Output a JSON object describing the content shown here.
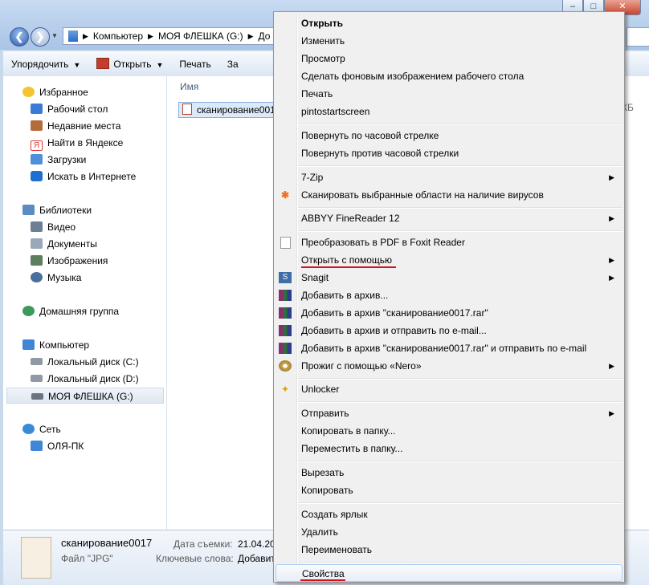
{
  "window": {
    "buttons": [
      "–",
      "□",
      "✕"
    ],
    "nav_back": "❮",
    "nav_forward": "❯",
    "address": [
      "Компьютер",
      "МОЯ ФЛЕШКА (G:)",
      "До"
    ]
  },
  "toolbar": {
    "organize": "Упорядочить",
    "open": "Открыть",
    "print": "Печать",
    "more": "За"
  },
  "nav": {
    "favorites": "Избранное",
    "desktop": "Рабочий стол",
    "recent": "Недавние места",
    "yandex": "Найти в Яндексе",
    "downloads": "Загрузки",
    "internet": "Искать в Интернете",
    "libraries": "Библиотеки",
    "video": "Видео",
    "documents": "Документы",
    "images": "Изображения",
    "music": "Музыка",
    "homegroup": "Домашняя группа",
    "computer": "Компьютер",
    "disk_c": "Локальный диск (C:)",
    "disk_d": "Локальный диск (D:)",
    "flash": "МОЯ ФЛЕШКА (G:)",
    "network": "Сеть",
    "pc": "ОЛЯ-ПК"
  },
  "files": {
    "col_name": "Имя",
    "file_name": "сканирование0017",
    "size_fragment": "КБ"
  },
  "details": {
    "name": "сканирование0017",
    "type": "Файл \"JPG\"",
    "date_label": "Дата съемки:",
    "date_value": "21.04.201",
    "keywords_label": "Ключевые слова:",
    "keywords_value": "Добавит"
  },
  "menu": {
    "open": "Открыть",
    "edit": "Изменить",
    "preview": "Просмотр",
    "set_bg": "Сделать фоновым изображением рабочего стола",
    "print": "Печать",
    "pinto": "pintostartscreen",
    "rotate_cw": "Повернуть по часовой стрелке",
    "rotate_ccw": "Повернуть против часовой стрелки",
    "zip": "7-Zip",
    "scan": "Сканировать выбранные области на наличие вирусов",
    "abbyy": "ABBYY FineReader 12",
    "foxit": "Преобразовать в PDF в Foxit Reader",
    "open_with": "Открыть с помощью",
    "snagit": "Snagit",
    "add_archive": "Добавить в архив...",
    "add_rar": "Добавить в архив \"сканирование0017.rar\"",
    "add_email": "Добавить в архив и отправить по e-mail...",
    "add_rar_email": "Добавить в архив \"сканирование0017.rar\" и отправить по e-mail",
    "nero": "Прожиг с помощью «Nero»",
    "unlocker": "Unlocker",
    "send_to": "Отправить",
    "copy_to": "Копировать в папку...",
    "move_to": "Переместить в папку...",
    "cut": "Вырезать",
    "copy": "Копировать",
    "shortcut": "Создать ярлык",
    "delete": "Удалить",
    "rename": "Переименовать",
    "properties": "Свойства"
  },
  "colors": {
    "annotation_underline": "#d8101c",
    "menu_highlight_border": "#aecff7",
    "selection_bg": "#dce9f8"
  },
  "icons": {
    "submenu_arrow": "▶"
  }
}
